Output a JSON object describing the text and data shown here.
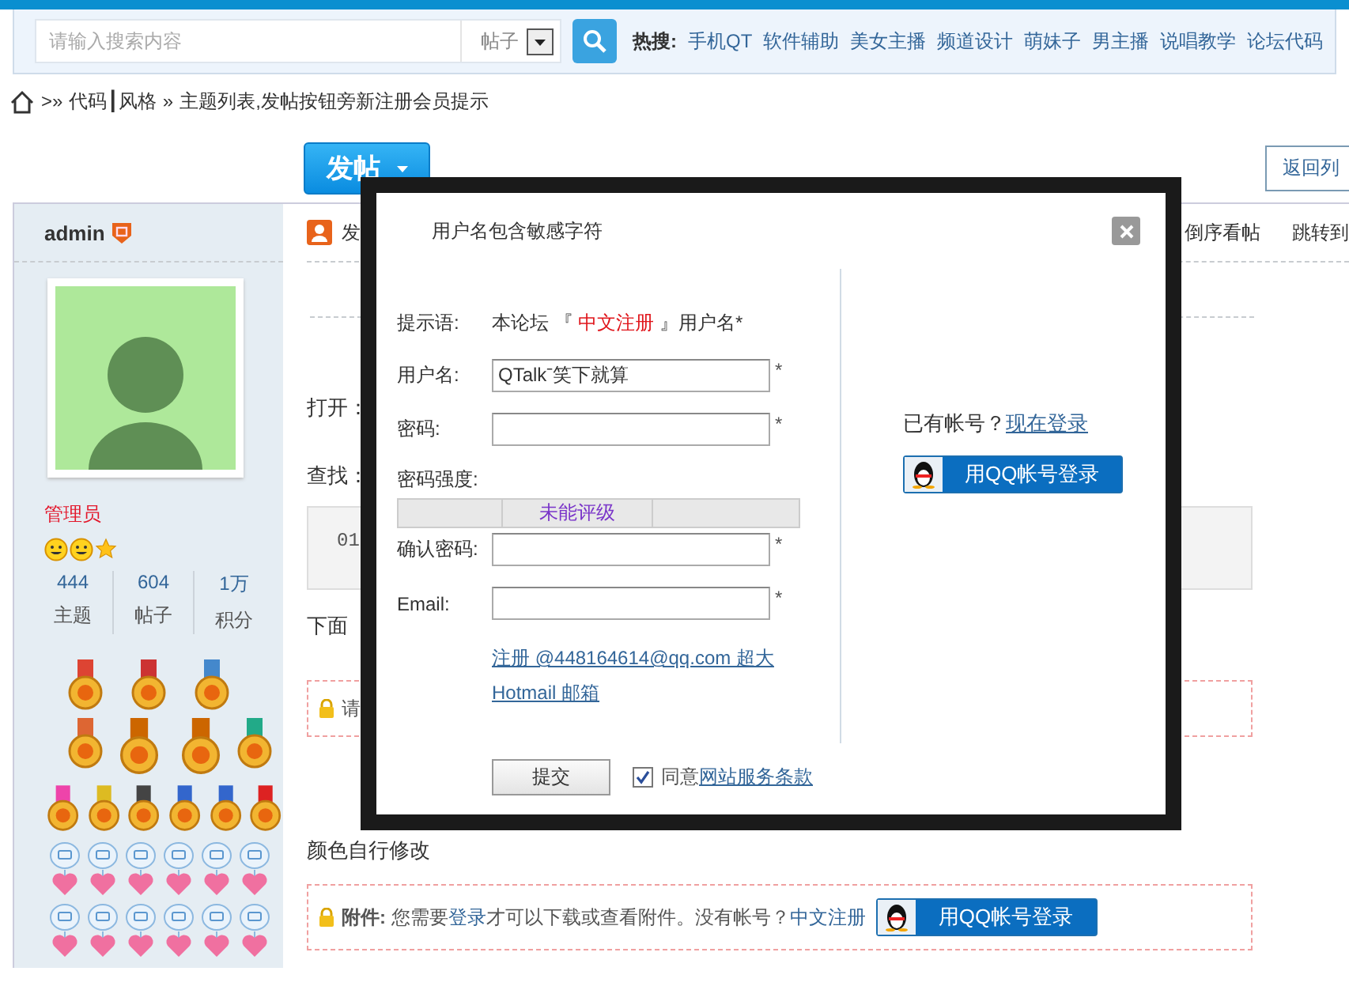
{
  "search": {
    "placeholder": "请输入搜索内容",
    "category": "帖子",
    "hot_label": "热搜:",
    "hot_links": [
      "手机QT",
      "软件辅助",
      "美女主播",
      "频道设计",
      "萌妹子",
      "男主播",
      "说唱教学",
      "论坛代码"
    ]
  },
  "breadcrumb": {
    "separator": ">»",
    "forum": "代码┃风格",
    "arrow": "»",
    "current": "主题列表,发帖按钮旁新注册会员提示"
  },
  "post_button": "发帖",
  "back_button": "返回列",
  "author": {
    "name": "admin",
    "group": "管理员",
    "stats": [
      {
        "value": "444",
        "label": "主题"
      },
      {
        "value": "604",
        "label": "帖子"
      },
      {
        "value": "1万",
        "label": "积分"
      }
    ]
  },
  "post_toolbar": {
    "author_text": "发",
    "links": [
      "倒序看帖",
      "跳转到"
    ]
  },
  "post_body": {
    "lines": [
      "打开：",
      "查找："
    ],
    "code_line": "01",
    "note": "下面",
    "locked_text": "请",
    "section_title": "颜色自行修改",
    "attachment": {
      "label": "附件:",
      "before": "您需要",
      "login_link": "登录",
      "after": "才可以下载或查看附件。没有帐号？",
      "register_link": "中文注册",
      "qq_button": "用QQ帐号登录"
    }
  },
  "modal": {
    "title": "用户名包含敏感字符",
    "hint": {
      "label": "提示语:",
      "before": "本论坛 『 ",
      "link": "中文注册",
      "after": " 』用户名*"
    },
    "fields": [
      {
        "kind": "input",
        "label": "用户名:",
        "value": "QTalkˉ笑下就算",
        "required_mark": "*"
      },
      {
        "kind": "input",
        "label": "密码:",
        "required_mark": "*"
      },
      {
        "kind": "strength",
        "label": "密码强度:",
        "rating": "未能评级"
      },
      {
        "kind": "input",
        "label": "确认密码:",
        "required_mark": "*"
      },
      {
        "kind": "input",
        "label": "Email:",
        "required_mark": "*"
      }
    ],
    "email_promo": [
      "注册 @448164614@qq.com 超大",
      "Hotmail 邮箱"
    ],
    "submit": "提交",
    "agree": {
      "checked": true,
      "label": "同意",
      "link": "网站服务条款"
    },
    "login": {
      "prompt": "已有帐号？",
      "link": "现在登录",
      "qq_button": "用QQ帐号登录"
    }
  }
}
